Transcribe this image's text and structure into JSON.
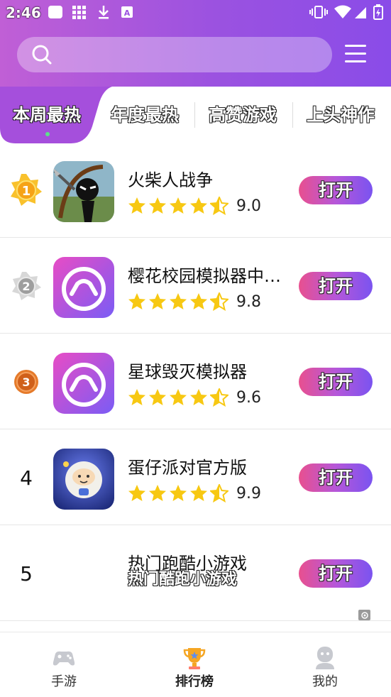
{
  "status_bar": {
    "time": "2:46"
  },
  "search": {
    "placeholder": ""
  },
  "tabs": [
    {
      "label": "本周最热",
      "active": true
    },
    {
      "label": "年度最热",
      "active": false
    },
    {
      "label": "高赞游戏",
      "active": false
    },
    {
      "label": "上头神作",
      "active": false
    }
  ],
  "ranking": [
    {
      "rank": "1",
      "name": "火柴人战争",
      "rating": "9.0",
      "button": "打开"
    },
    {
      "rank": "2",
      "name": "樱花校园模拟器中…",
      "rating": "9.8",
      "button": "打开"
    },
    {
      "rank": "3",
      "name": "星球毁灭模拟器",
      "rating": "9.6",
      "button": "打开"
    },
    {
      "rank": "4",
      "name": "蛋仔派对官方版",
      "rating": "9.9",
      "button": "打开"
    },
    {
      "rank": "5",
      "name": "热门跑酷小游戏",
      "subtitle": "热门酷跑小游戏",
      "button": "打开"
    }
  ],
  "bottom_nav": [
    {
      "label": "手游",
      "active": false
    },
    {
      "label": "排行榜",
      "active": true
    },
    {
      "label": "我的",
      "active": false
    }
  ],
  "colors": {
    "header_gradient_start": "#c05fd6",
    "header_gradient_end": "#8a4ce8",
    "star": "#f7c812",
    "button_gradient_start": "#e8508f",
    "button_gradient_end": "#7a53f0"
  }
}
